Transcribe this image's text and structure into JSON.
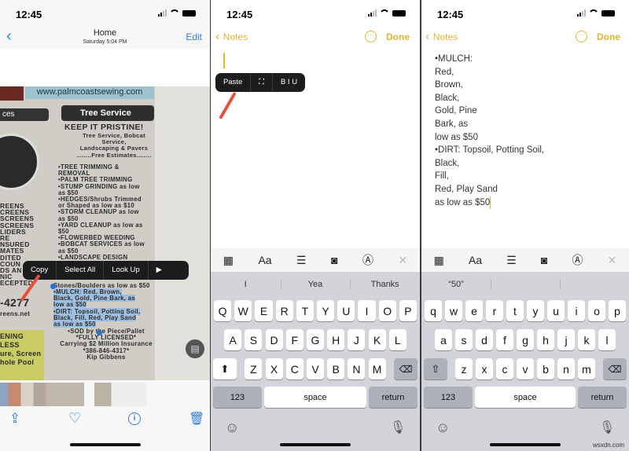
{
  "status": {
    "time": "12:45"
  },
  "photos": {
    "nav": {
      "title": "Home",
      "subtitle": "Saturday  5:04 PM",
      "edit": "Edit"
    },
    "newspaper": {
      "url": "www.palmcoastsewing.com",
      "section": "Tree Service",
      "left_tab": "ces",
      "seal": "SCREENS 479-4277",
      "left_col": [
        "REENS",
        "CREENS",
        "SCREENS",
        "SCREENS",
        "LIDERS",
        "RE",
        "NSURED",
        "MATES",
        "DITED",
        "COUN",
        "DS AN",
        "NIC",
        "ECEPTED"
      ],
      "left_phone": "-4277",
      "left_url": "reens.net",
      "left_ad": [
        "ENING",
        "LESS",
        "ure, Screen",
        "hole Pool"
      ],
      "heading": "KEEP IT PRISTINE!",
      "intro": [
        "Tree Service, Bobcat",
        "Service,",
        "Landscaping & Pavers",
        "........Free Estimates........"
      ],
      "items": [
        "•TREE  TRIMMING  &",
        "REMOVAL",
        "•PALM TREE TRIMMING",
        "•STUMP GRINDING as low",
        "as $50",
        "•HEDGES/Shrubs  Trimmed",
        "or Shaped as low as $10",
        "•STORM CLEANUP as low",
        "as $50",
        "•YARD CLEANUP as low as",
        "$50",
        "•FLOWERBED WEEDING",
        "•BOBCAT SERVICES as low",
        "as $50",
        "•LANDSCAPE DESIGN"
      ],
      "stones": "Stones/Boulders as low as $50",
      "selected": [
        "•MULCH:  Red,  Brown,",
        "Black, Gold, Pine Bark, as",
        "low as $50",
        "•DIRT: Topsoil, Potting Soil,",
        "Black, Fill, Red, Play Sand",
        "as low as $50"
      ],
      "footer": [
        "•SOD by the Piece/Pallet",
        "*FULLY LICENSED*",
        "Carrying $2 Million Insurance",
        "*386-846-4317*",
        "Kip Gibbens"
      ]
    },
    "menu": [
      "Copy",
      "Select All",
      "Look Up",
      "▶"
    ]
  },
  "notes_paste": {
    "back": "Notes",
    "done": "Done",
    "menu": [
      "Paste",
      "⛶",
      "B I U"
    ],
    "suggestions": [
      "I",
      "Yea",
      "Thanks"
    ]
  },
  "notes_result": {
    "back": "Notes",
    "done": "Done",
    "lines": [
      "•MULCH:",
      "Red,",
      "Brown,",
      "Black,",
      "Gold, Pine",
      "Bark, as",
      "low as $50",
      "•DIRT: Topsoil, Potting Soil,",
      "Black,",
      "Fill,",
      "Red, Play Sand",
      "as low as $50"
    ],
    "suggestions": [
      "“50”",
      "",
      ""
    ]
  },
  "keyboard": {
    "upper": [
      [
        "Q",
        "W",
        "E",
        "R",
        "T",
        "Y",
        "U",
        "I",
        "O",
        "P"
      ],
      [
        "A",
        "S",
        "D",
        "F",
        "G",
        "H",
        "J",
        "K",
        "L"
      ],
      [
        "Z",
        "X",
        "C",
        "V",
        "B",
        "N",
        "M"
      ]
    ],
    "lower": [
      [
        "q",
        "w",
        "e",
        "r",
        "t",
        "y",
        "u",
        "i",
        "o",
        "p"
      ],
      [
        "a",
        "s",
        "d",
        "f",
        "g",
        "h",
        "j",
        "k",
        "l"
      ],
      [
        "z",
        "x",
        "c",
        "v",
        "b",
        "n",
        "m"
      ]
    ],
    "numbers": "123",
    "space": "space",
    "return": "return",
    "toolbar": [
      "table-icon",
      "Aa",
      "checklist-icon",
      "camera-icon",
      "markup-icon",
      "close-icon"
    ],
    "format_label": "Aa"
  },
  "watermark": "wsxdn.com",
  "colors": {
    "ios_blue": "#2f7fd6",
    "notes_gold": "#e3b331",
    "selection": "#9fbfe0",
    "arrow": "#e8503a"
  }
}
